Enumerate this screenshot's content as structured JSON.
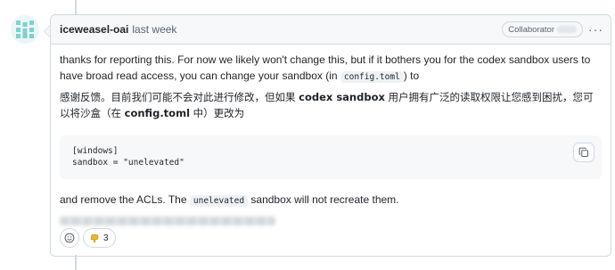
{
  "comment": {
    "author": "iceweasel-oai",
    "timestamp": "last week",
    "badge_label": "Collaborator",
    "menu_label": "···"
  },
  "body": {
    "para1_part1": "thanks for reporting this. For now we likely won't change this, but if it bothers you for the codex sandbox users to have broad read access, you can change your sandbox (in ",
    "para1_code": "config.toml",
    "para1_part2": ") to",
    "para_cn_1": "感谢反馈。目前我们可能不会对此进行修改，但如果 ",
    "para_cn_bold_1": "codex sandbox",
    "para_cn_2": " 用户拥有广泛的读取权限让您感到困扰，您可以将沙盒（在 ",
    "para_cn_bold_2": "config.toml",
    "para_cn_3": " 中）更改为",
    "code_line1": "[windows]",
    "code_line2": "sandbox = \"unelevated\"",
    "para2_part1": "and remove the ACLs. The ",
    "para2_code": "unelevated",
    "para2_part2": " sandbox will not recreate them."
  },
  "reactions": {
    "thumbs_down_count": "3"
  },
  "icons": {
    "copy": "copy-icon",
    "smiley": "smiley-icon",
    "thumbs_down": "thumbs-down-icon",
    "kebab": "kebab-horizontal-icon"
  },
  "colors": {
    "border": "#d1d9e0",
    "header_bg": "#f6f8fa",
    "text": "#1f2328",
    "muted": "#59636e",
    "avatar_accent": "#7fd1cf"
  }
}
